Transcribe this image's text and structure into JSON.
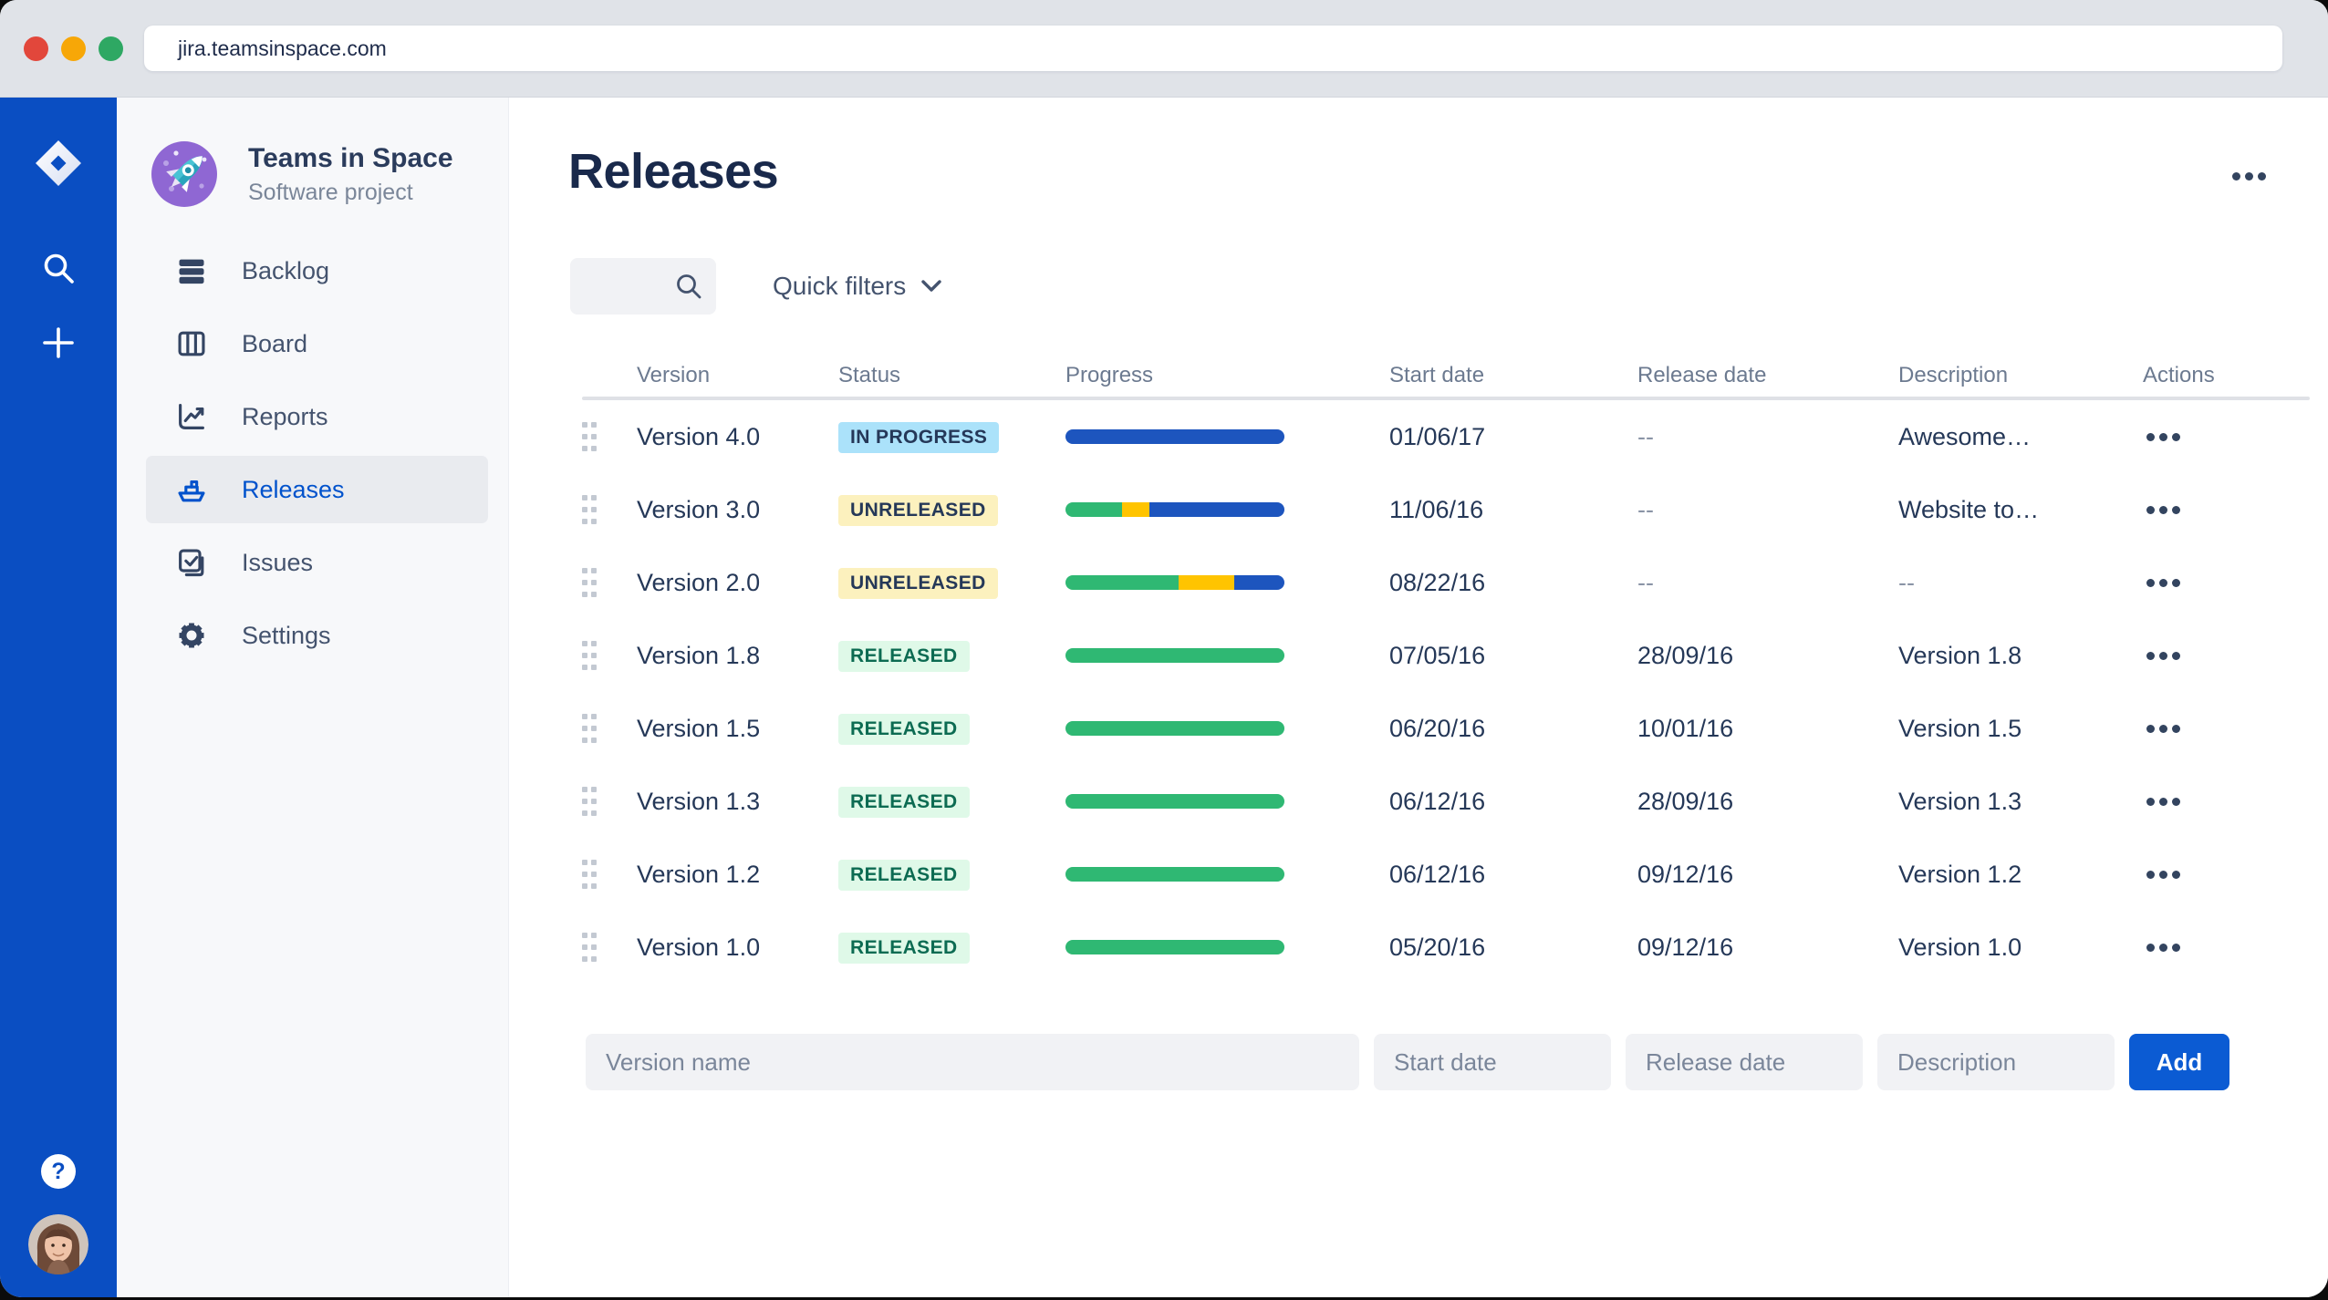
{
  "browser": {
    "url": "jira.teamsinspace.com",
    "traffic_lights": [
      {
        "name": "close",
        "color": "#E2473B"
      },
      {
        "name": "minimize",
        "color": "#F7A707"
      },
      {
        "name": "zoom",
        "color": "#2EA863"
      }
    ]
  },
  "sidebar": {
    "project_name": "Teams in Space",
    "project_type": "Software project",
    "items": [
      {
        "label": "Backlog",
        "icon": "backlog",
        "selected": false
      },
      {
        "label": "Board",
        "icon": "board",
        "selected": false
      },
      {
        "label": "Reports",
        "icon": "reports",
        "selected": false
      },
      {
        "label": "Releases",
        "icon": "releases",
        "selected": true
      },
      {
        "label": "Issues",
        "icon": "issues",
        "selected": false
      },
      {
        "label": "Settings",
        "icon": "settings",
        "selected": false
      }
    ]
  },
  "page": {
    "title": "Releases",
    "quick_filters_label": "Quick filters",
    "search_value": "",
    "search_placeholder": ""
  },
  "table": {
    "columns": [
      "Version",
      "Status",
      "Progress",
      "Start date",
      "Release date",
      "Description",
      "Actions"
    ],
    "rows": [
      {
        "version": "Version 4.0",
        "status": "IN PROGRESS",
        "status_type": "in-progress",
        "progress": [
          {
            "color": "blue",
            "pct": 100
          }
        ],
        "start_date": "01/06/17",
        "release_date": "--",
        "description": "Awesome…"
      },
      {
        "version": "Version 3.0",
        "status": "UNRELEASED",
        "status_type": "unreleased",
        "progress": [
          {
            "color": "green",
            "pct": 26
          },
          {
            "color": "yellow",
            "pct": 12.5
          },
          {
            "color": "blue",
            "pct": 61.5
          }
        ],
        "start_date": "11/06/16",
        "release_date": "--",
        "description": "Website to…"
      },
      {
        "version": "Version 2.0",
        "status": "UNRELEASED",
        "status_type": "unreleased",
        "progress": [
          {
            "color": "green",
            "pct": 51.5
          },
          {
            "color": "yellow",
            "pct": 25.5
          },
          {
            "color": "blue",
            "pct": 23
          }
        ],
        "start_date": "08/22/16",
        "release_date": "--",
        "description": "--"
      },
      {
        "version": "Version 1.8",
        "status": "RELEASED",
        "status_type": "released",
        "progress": [
          {
            "color": "green",
            "pct": 100
          }
        ],
        "start_date": "07/05/16",
        "release_date": "28/09/16",
        "description": "Version 1.8"
      },
      {
        "version": "Version 1.5",
        "status": "RELEASED",
        "status_type": "released",
        "progress": [
          {
            "color": "green",
            "pct": 100
          }
        ],
        "start_date": "06/20/16",
        "release_date": "10/01/16",
        "description": "Version 1.5"
      },
      {
        "version": "Version 1.3",
        "status": "RELEASED",
        "status_type": "released",
        "progress": [
          {
            "color": "green",
            "pct": 100
          }
        ],
        "start_date": "06/12/16",
        "release_date": "28/09/16",
        "description": "Version 1.3"
      },
      {
        "version": "Version 1.2",
        "status": "RELEASED",
        "status_type": "released",
        "progress": [
          {
            "color": "green",
            "pct": 100
          }
        ],
        "start_date": "06/12/16",
        "release_date": "09/12/16",
        "description": "Version 1.2"
      },
      {
        "version": "Version 1.0",
        "status": "RELEASED",
        "status_type": "released",
        "progress": [
          {
            "color": "green",
            "pct": 100
          }
        ],
        "start_date": "05/20/16",
        "release_date": "09/12/16",
        "description": "Version 1.0"
      }
    ]
  },
  "form": {
    "fields": [
      {
        "key": "version",
        "placeholder": "Version name"
      },
      {
        "key": "start",
        "placeholder": "Start date"
      },
      {
        "key": "release",
        "placeholder": "Release date"
      },
      {
        "key": "desc",
        "placeholder": "Description"
      }
    ],
    "add_label": "Add"
  },
  "colors": {
    "progress_green": "#2FB873",
    "progress_yellow": "#FFC400",
    "progress_blue": "#1D55BE",
    "badge_in_progress_bg": "#ABE2FA",
    "badge_unreleased_bg": "#FCF1BE",
    "badge_released_bg": "#DFF9E8",
    "badge_released_text": "#0C6B52",
    "accent_blue": "#0052CC",
    "sidebar_blue": "#0A4EC2",
    "add_button_blue": "#0B5BD3"
  }
}
